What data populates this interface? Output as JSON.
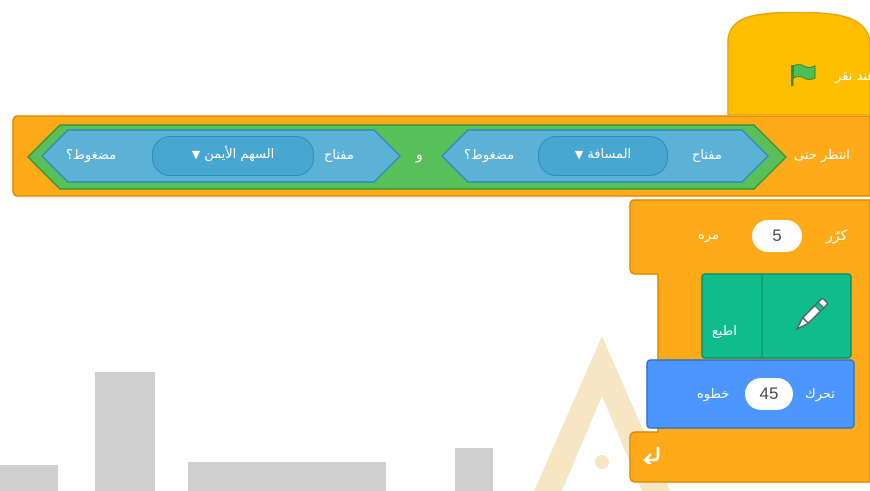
{
  "colors": {
    "events": "#FFBF00",
    "control": "#FFAB19",
    "sensing": "#5CB1D6",
    "operators": "#59C059",
    "pen": "#0FBD8C",
    "motion": "#4C97FF",
    "watermark": "#CFCFCF"
  },
  "hat_block": {
    "label": "عند نقر",
    "icon": "green-flag-icon"
  },
  "wait_until_block": {
    "label": "انتظر حتى",
    "and_operator": "و",
    "condition_1": {
      "prefix": "مفتاح",
      "key": "المسافة",
      "suffix": "مضغوط؟"
    },
    "condition_2": {
      "prefix": "مفتاح",
      "key": "السهم الأيمن",
      "suffix": "مضغوط؟"
    }
  },
  "repeat_block": {
    "label": "كرّر",
    "count": "5",
    "suffix": "مره",
    "loop_icon": "loop-arrow-icon"
  },
  "pen_block": {
    "label": "اطبع",
    "icon": "pen-icon"
  },
  "move_block": {
    "label": "تحرك",
    "steps": "45",
    "suffix": "خطوه"
  }
}
